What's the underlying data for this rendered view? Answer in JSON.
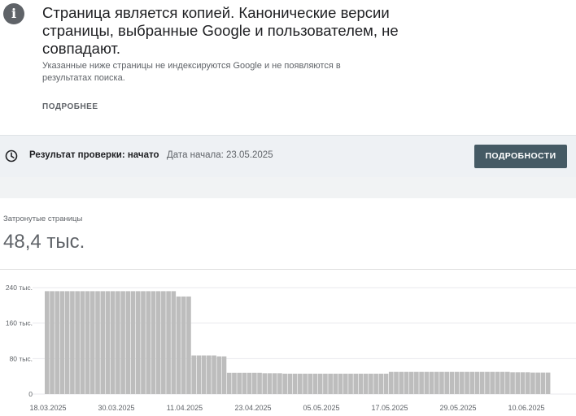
{
  "notice": {
    "icon": "info-icon",
    "headline": "Страница является копией. Канонические версии страницы, выбранные Google и пользователем, не совпадают.",
    "subtext": "Указанные ниже страницы не индексируются Google и не появляются в результатах поиска.",
    "more_link": "ПОДРОБНЕЕ"
  },
  "validation": {
    "icon": "clock-icon",
    "status": "Результат проверки: начато",
    "start_date": "Дата начала: 23.05.2025",
    "details_button": "ПОДРОБНОСТИ"
  },
  "metric": {
    "label": "Затронутые страницы",
    "value": "48,4 тыс."
  },
  "colors": {
    "bar": "#bdbdbd",
    "button": "#455a64",
    "gridline": "#e8eaed"
  },
  "chart_data": {
    "type": "bar",
    "ylim": [
      0,
      240000
    ],
    "yticks": [
      0,
      80000,
      160000,
      240000
    ],
    "ytick_labels": [
      "0",
      "80 тыс.",
      "160 тыс.",
      "240 тыс."
    ],
    "xtick_labels": [
      "18.03.2025",
      "30.03.2025",
      "11.04.2025",
      "23.04.2025",
      "05.05.2025",
      "17.05.2025",
      "29.05.2025",
      "10.06.2025"
    ],
    "grid": true,
    "values": [
      232000,
      232000,
      232000,
      232000,
      232000,
      232000,
      232000,
      232000,
      232000,
      232000,
      232000,
      232000,
      232000,
      232000,
      232000,
      232000,
      232000,
      232000,
      232000,
      232000,
      232000,
      232000,
      232000,
      232000,
      232000,
      232000,
      220000,
      220000,
      220000,
      87000,
      87000,
      87000,
      87000,
      87000,
      85000,
      85000,
      48000,
      48000,
      48000,
      48000,
      48000,
      48000,
      48000,
      47000,
      47000,
      47000,
      47000,
      46000,
      46000,
      46000,
      46000,
      46000,
      46000,
      46000,
      46000,
      46000,
      46000,
      46000,
      46000,
      46000,
      46000,
      46000,
      46000,
      46000,
      46000,
      46000,
      46000,
      46000,
      50000,
      50000,
      50000,
      50000,
      50000,
      50000,
      50000,
      50000,
      50000,
      50000,
      50000,
      50000,
      50000,
      50000,
      50000,
      50000,
      50000,
      50000,
      50000,
      50000,
      50000,
      50000,
      50000,
      50000,
      49000,
      49000,
      49000,
      49000,
      48400,
      48400,
      48400,
      48400
    ]
  }
}
